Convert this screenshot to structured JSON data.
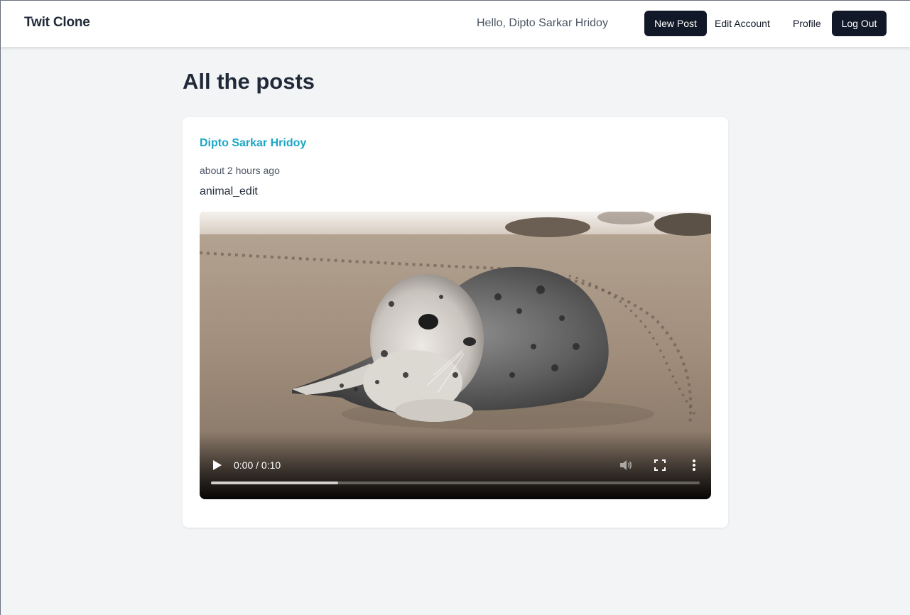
{
  "navbar": {
    "brand": "Twit Clone",
    "greeting": "Hello, Dipto Sarkar Hridoy",
    "new_post_label": "New Post",
    "edit_account_label": "Edit Account",
    "profile_label": "Profile",
    "logout_label": "Log Out"
  },
  "main": {
    "title": "All the posts"
  },
  "posts": [
    {
      "author": "Dipto Sarkar Hridoy",
      "timestamp": "about 2 hours ago",
      "text": "animal_edit",
      "video": {
        "time": "0:00 / 0:10",
        "buffered_fraction": 0.26,
        "muted": true
      }
    }
  ],
  "colors": {
    "accent": "#1ba6c5",
    "dark_button": "#111827",
    "background": "#f3f4f6"
  },
  "icons": [
    "play-icon",
    "volume-icon",
    "fullscreen-icon",
    "more-vert-icon"
  ]
}
